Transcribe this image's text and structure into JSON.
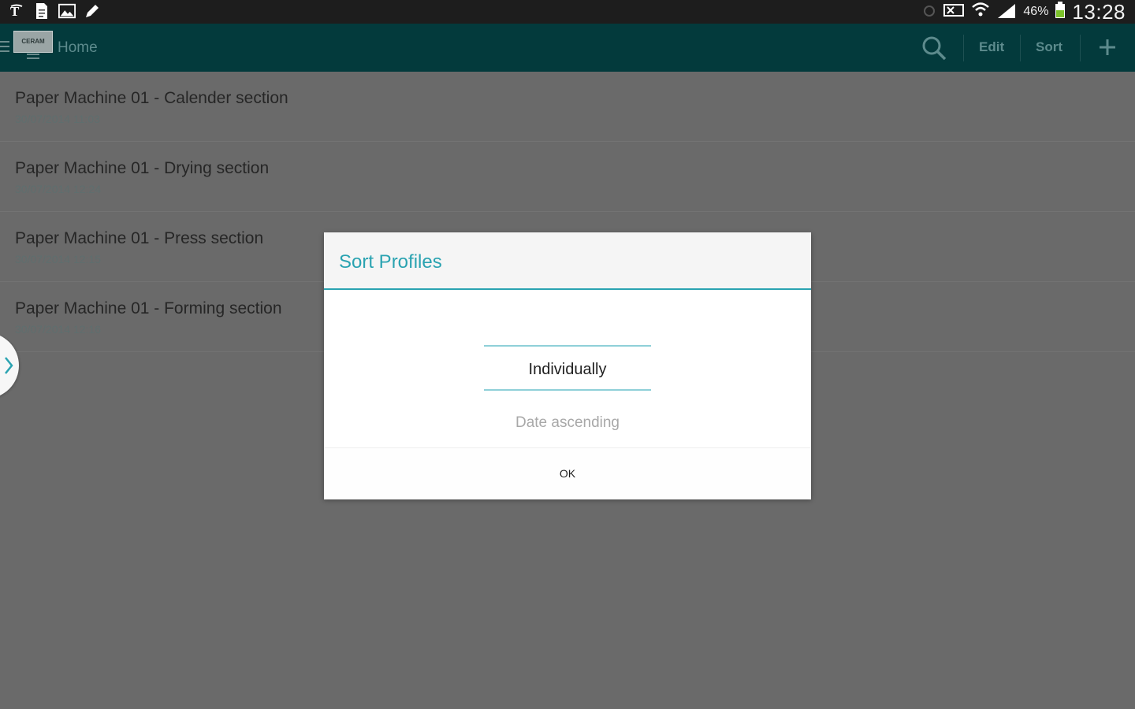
{
  "status_bar": {
    "battery_percent": "46%",
    "time": "13:28",
    "left_icons": [
      "notification-app-icon",
      "document-icon",
      "image-icon",
      "pen-icon"
    ],
    "right_icons": [
      "alarm-icon",
      "mute-icon",
      "wifi-icon",
      "signal-icon",
      "battery-icon"
    ]
  },
  "action_bar": {
    "title": "Home",
    "edit_label": "Edit",
    "sort_label": "Sort",
    "search_icon": "search-icon",
    "add_icon": "add-icon"
  },
  "profiles": [
    {
      "title": "Paper Machine 01 - Calender section",
      "date": "30/07/2014  11:03"
    },
    {
      "title": "Paper Machine 01 - Drying section",
      "date": "30/07/2014  12:24"
    },
    {
      "title": "Paper Machine 01 - Press section",
      "date": "30/07/2014  12:15"
    },
    {
      "title": "Paper Machine 01 - Forming section",
      "date": "30/07/2014  12:16"
    }
  ],
  "dialog": {
    "title": "Sort Profiles",
    "selected_option": "Individually",
    "next_option": "Date ascending",
    "ok_label": "OK"
  },
  "colors": {
    "action_bar": "#033a3c",
    "accent": "#2aa3b1",
    "overlay_background": "#6a6a6a"
  }
}
